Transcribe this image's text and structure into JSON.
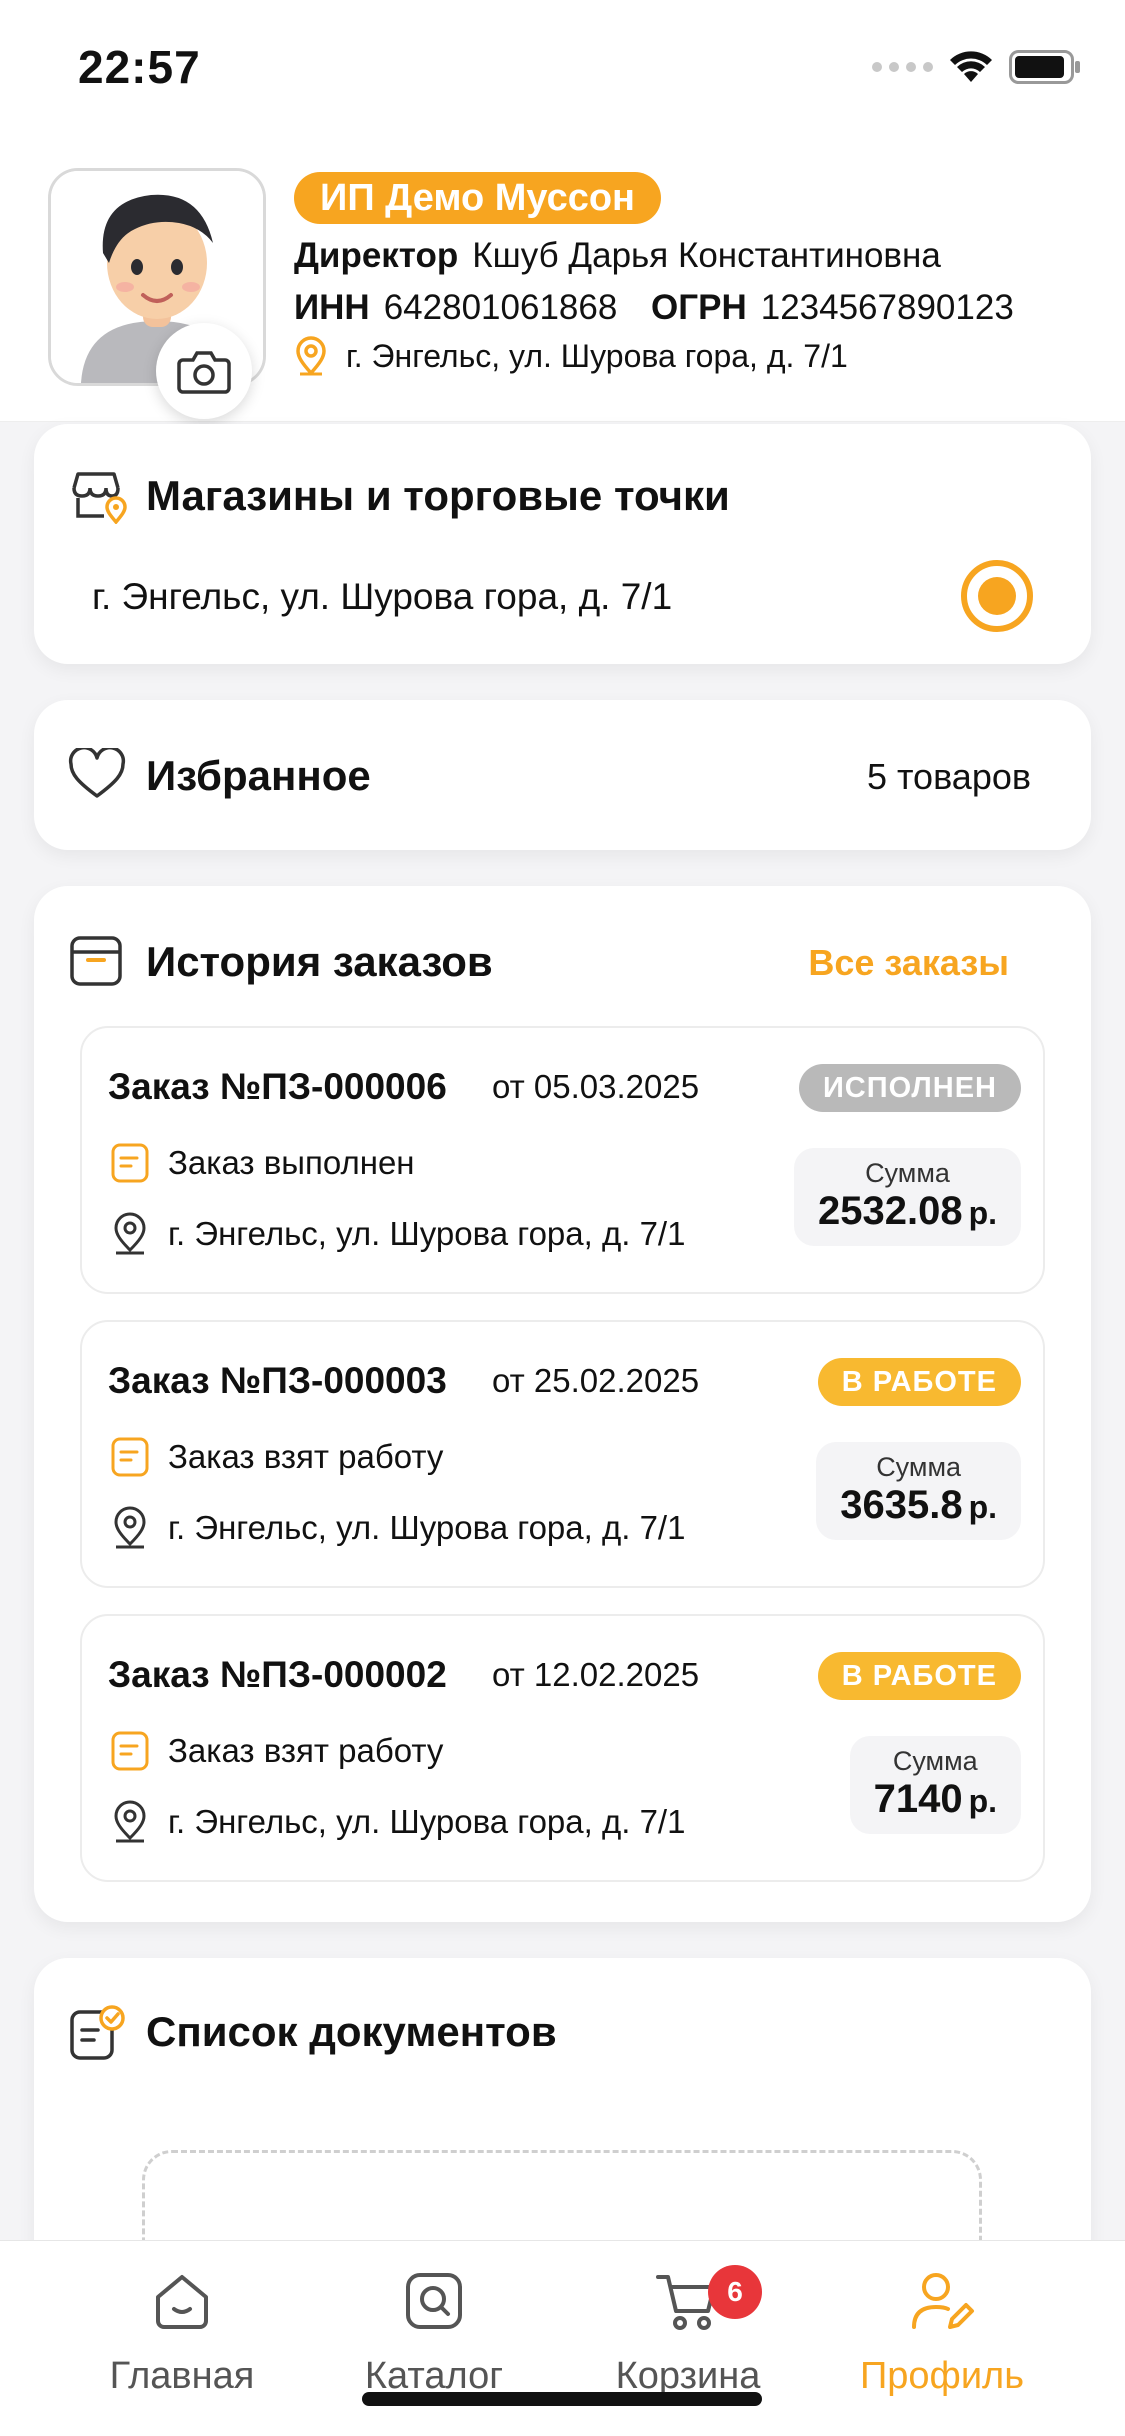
{
  "status_bar": {
    "time": "22:57"
  },
  "profile": {
    "org_name": "ИП Демо Муссон",
    "director_label": "Директор",
    "director_name": "Кшуб Дарья Константиновна",
    "inn_label": "ИНН",
    "inn_value": "642801061868",
    "ogrn_label": "ОГРН",
    "ogrn_value": "1234567890123",
    "address": "г. Энгельс, ул. Шурова гора, д. 7/1"
  },
  "shops": {
    "title": "Магазины и торговые точки",
    "address": "г. Энгельс, ул. Шурова гора, д. 7/1"
  },
  "favorites": {
    "title": "Избранное",
    "count": "5 товаров"
  },
  "orders": {
    "title": "История заказов",
    "all_link": "Все заказы",
    "items": [
      {
        "number": "Заказ №ПЗ-000006",
        "date": "от 05.03.2025",
        "badge": "ИСПОЛНЕН",
        "status": "Заказ выполнен",
        "address": "г. Энгельс, ул. Шурова гора, д. 7/1",
        "sum_label": "Сумма",
        "sum": "2532.08",
        "currency": "р."
      },
      {
        "number": "Заказ №ПЗ-000003",
        "date": "от 25.02.2025",
        "badge": "В РАБОТЕ",
        "status": "Заказ взят работу",
        "address": "г. Энгельс, ул. Шурова гора, д. 7/1",
        "sum_label": "Сумма",
        "sum": "3635.8",
        "currency": "р."
      },
      {
        "number": "Заказ №ПЗ-000002",
        "date": "от 12.02.2025",
        "badge": "В РАБОТЕ",
        "status": "Заказ взят работу",
        "address": "г. Энгельс, ул. Шурова гора, д. 7/1",
        "sum_label": "Сумма",
        "sum": "7140",
        "currency": "р."
      }
    ]
  },
  "documents": {
    "title": "Список документов"
  },
  "tabs": {
    "home": "Главная",
    "catalog": "Каталог",
    "cart": "Корзина",
    "cart_badge": "6",
    "profile": "Профиль"
  },
  "colors": {
    "accent": "#f7a520",
    "badge_done": "#b9b9b9",
    "badge_work": "#f8b930",
    "cart_badge": "#e8363a"
  }
}
